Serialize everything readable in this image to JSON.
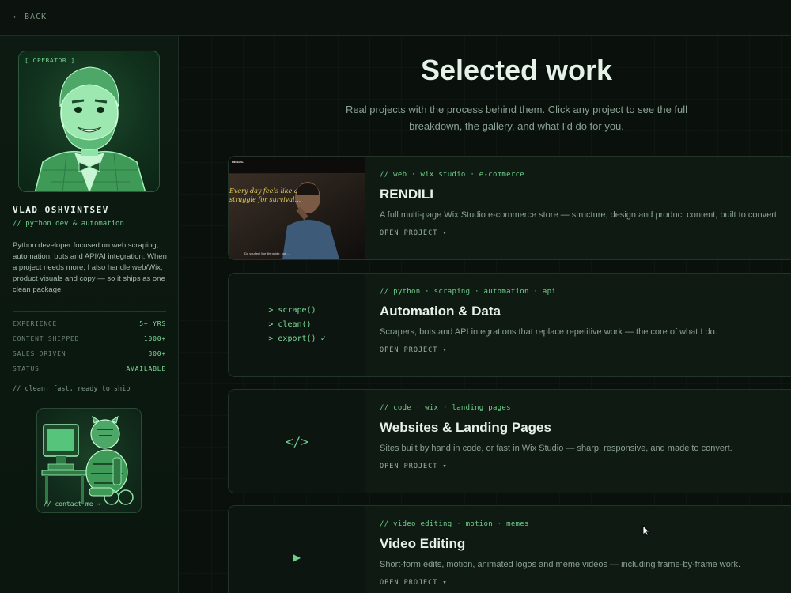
{
  "topbar": {
    "back_label": "← BACK"
  },
  "sidebar": {
    "portrait_tag": "[ OPERATOR ]",
    "name": "VLAD OSHVINTSEV",
    "role": "// python dev & automation",
    "bio": "Python developer focused on web scraping, automation, bots and API/AI integration. When a project needs more, I also handle web/Wix, product visuals and copy — so it ships as one clean package.",
    "stats": [
      {
        "label": "EXPERIENCE",
        "value": "5+ YRS"
      },
      {
        "label": "CONTENT SHIPPED",
        "value": "1000+"
      },
      {
        "label": "SALES DRIVEN",
        "value": "300+"
      },
      {
        "label": "STATUS",
        "value": "AVAILABLE"
      }
    ],
    "tagline": "// clean, fast, ready to ship",
    "contact_label": "// contact me →"
  },
  "main": {
    "title": "Selected work",
    "subtitle": "Real projects with the process behind them. Click any project to see the full breakdown, the gallery, and what I'd do for you.",
    "projects": [
      {
        "tags": "// web · wix studio · e-commerce",
        "title": "RENDILI",
        "desc": "A full multi-page Wix Studio e-commerce store — structure, design and product content, built to convert.",
        "open": "OPEN PROJECT ▾",
        "thumb": {
          "logo": "RENDILI",
          "quote": "Every day feels like a struggle for survival...",
          "caption": "Do you feel like life guide, but ..."
        }
      },
      {
        "tags": "// python · scraping · automation · api",
        "title": "Automation & Data",
        "desc": "Scrapers, bots and API integrations that replace repetitive work — the core of what I do.",
        "open": "OPEN PROJECT ▾",
        "code": [
          "> scrape()",
          "> clean()",
          "> export() ✓"
        ]
      },
      {
        "tags": "// code · wix · landing pages",
        "title": "Websites & Landing Pages",
        "desc": "Sites built by hand in code, or fast in Wix Studio — sharp, responsive, and made to convert.",
        "open": "OPEN PROJECT ▾",
        "glyph": "</>"
      },
      {
        "tags": "// video editing · motion · memes",
        "title": "Video Editing",
        "desc": "Short-form edits, motion, animated logos and meme videos — including frame-by-frame work.",
        "open": "OPEN PROJECT ▾",
        "glyph": "▶"
      }
    ]
  },
  "icons": {
    "play": "play-icon",
    "code": "code-icon",
    "cursor": "mouse-cursor-icon"
  },
  "colors": {
    "accent": "#6fcf8a",
    "background": "#0a100c",
    "card": "#0f1a13"
  }
}
